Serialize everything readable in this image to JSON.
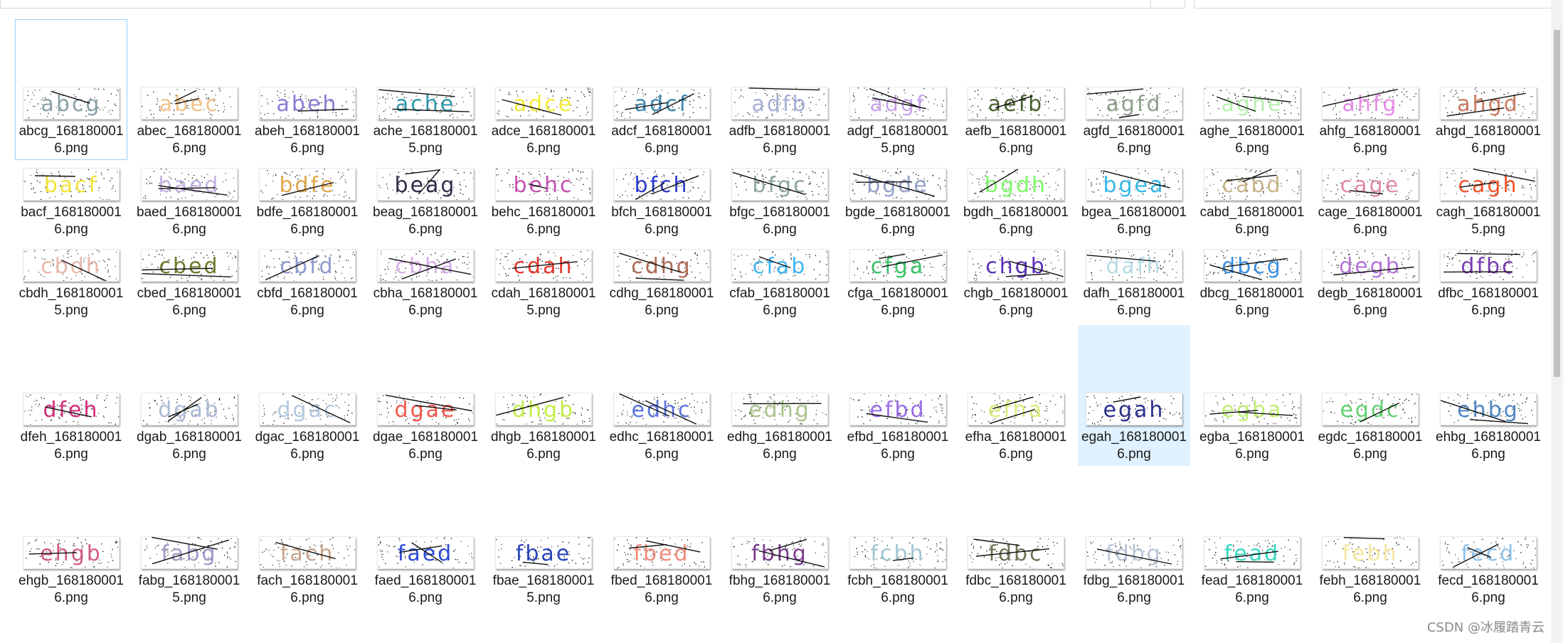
{
  "watermark": "CSDN @冰履踏青云",
  "files": [
    {
      "text": "abcg",
      "name": "abcg_1681800016.png",
      "color": "#8aa0a6"
    },
    {
      "text": "abec",
      "name": "abec_1681800016.png",
      "color": "#f1c48b"
    },
    {
      "text": "abeh",
      "name": "abeh_1681800016.png",
      "color": "#8c7ad6"
    },
    {
      "text": "ache",
      "name": "ache_1681800015.png",
      "color": "#2d97a8"
    },
    {
      "text": "adce",
      "name": "adce_1681800016.png",
      "color": "#f3ec36"
    },
    {
      "text": "adcf",
      "name": "adcf_1681800016.png",
      "color": "#3b86b0"
    },
    {
      "text": "adfb",
      "name": "adfb_1681800016.png",
      "color": "#a5b0d8"
    },
    {
      "text": "adgf",
      "name": "adgf_1681800015.png",
      "color": "#c7a3e8"
    },
    {
      "text": "aefb",
      "name": "aefb_1681800016.png",
      "color": "#4a6231"
    },
    {
      "text": "agfd",
      "name": "agfd_1681800016.png",
      "color": "#8ea08a"
    },
    {
      "text": "aghe",
      "name": "aghe_1681800016.png",
      "color": "#b8eeb0"
    },
    {
      "text": "ahfg",
      "name": "ahfg_1681800016.png",
      "color": "#e58be6"
    },
    {
      "text": "ahgd",
      "name": "ahgd_1681800016.png",
      "color": "#cb7a61"
    },
    {
      "text": "bacf",
      "name": "bacf_1681800016.png",
      "color": "#f3e23a"
    },
    {
      "text": "baed",
      "name": "baed_1681800016.png",
      "color": "#c4b5e2"
    },
    {
      "text": "bdfe",
      "name": "bdfe_1681800016.png",
      "color": "#e0a54a"
    },
    {
      "text": "beag",
      "name": "beag_1681800016.png",
      "color": "#2e2f4a"
    },
    {
      "text": "behc",
      "name": "behc_1681800016.png",
      "color": "#c54fb1"
    },
    {
      "text": "bfch",
      "name": "bfch_1681800016.png",
      "color": "#2b3ac9"
    },
    {
      "text": "bfgc",
      "name": "bfgc_1681800016.png",
      "color": "#8da79a"
    },
    {
      "text": "bgde",
      "name": "bgde_1681800016.png",
      "color": "#93a0c8"
    },
    {
      "text": "bgdh",
      "name": "bgdh_1681800016.png",
      "color": "#7ff56a"
    },
    {
      "text": "bgea",
      "name": "bgea_1681800016.png",
      "color": "#36b7e8"
    },
    {
      "text": "cabd",
      "name": "cabd_1681800016.png",
      "color": "#c9b58a"
    },
    {
      "text": "cage",
      "name": "cage_1681800016.png",
      "color": "#e08aa3"
    },
    {
      "text": "cagh",
      "name": "cagh_1681800015.png",
      "color": "#f0552a"
    },
    {
      "text": "cbdh",
      "name": "cbdh_1681800015.png",
      "color": "#e8b8a8"
    },
    {
      "text": "cbed",
      "name": "cbed_1681800016.png",
      "color": "#6f7a2b"
    },
    {
      "text": "cbfd",
      "name": "cbfd_1681800016.png",
      "color": "#8e9ad0"
    },
    {
      "text": "cbha",
      "name": "cbha_1681800016.png",
      "color": "#d7aee8"
    },
    {
      "text": "cdah",
      "name": "cdah_1681800015.png",
      "color": "#e4382e"
    },
    {
      "text": "cdhg",
      "name": "cdhg_1681800016.png",
      "color": "#b06d57"
    },
    {
      "text": "cfab",
      "name": "cfab_1681800016.png",
      "color": "#3fb6f2"
    },
    {
      "text": "cfga",
      "name": "cfga_1681800016.png",
      "color": "#3bc267"
    },
    {
      "text": "chgb",
      "name": "chgb_1681800016.png",
      "color": "#5b2fb7"
    },
    {
      "text": "dafh",
      "name": "dafh_1681800016.png",
      "color": "#b7dbe6"
    },
    {
      "text": "dbcg",
      "name": "dbcg_1681800016.png",
      "color": "#3a8fe0"
    },
    {
      "text": "degb",
      "name": "degb_1681800016.png",
      "color": "#b272d6"
    },
    {
      "text": "dfbc",
      "name": "dfbc_1681800016.png",
      "color": "#7a3cb3"
    },
    {
      "text": "dfeh",
      "name": "dfeh_1681800016.png",
      "color": "#d12f7c"
    },
    {
      "text": "dgab",
      "name": "dgab_1681800016.png",
      "color": "#aab8d4"
    },
    {
      "text": "dgac",
      "name": "dgac_1681800016.png",
      "color": "#b5c8df"
    },
    {
      "text": "dgae",
      "name": "dgae_1681800016.png",
      "color": "#f2574b"
    },
    {
      "text": "dhgb",
      "name": "dhgb_1681800016.png",
      "color": "#c1ee45"
    },
    {
      "text": "edhc",
      "name": "edhc_1681800016.png",
      "color": "#5b74e0"
    },
    {
      "text": "edhg",
      "name": "edhg_1681800016.png",
      "color": "#a9c289"
    },
    {
      "text": "efbd",
      "name": "efbd_1681800016.png",
      "color": "#9a6de8"
    },
    {
      "text": "efha",
      "name": "efha_1681800016.png",
      "color": "#d6ec7a"
    },
    {
      "text": "egah",
      "name": "egah_1681800016.png",
      "color": "#2a2f8c"
    },
    {
      "text": "egba",
      "name": "egba_1681800016.png",
      "color": "#c0ef75"
    },
    {
      "text": "egdc",
      "name": "egdc_1681800016.png",
      "color": "#5ed16d"
    },
    {
      "text": "ehbg",
      "name": "ehbg_1681800016.png",
      "color": "#4f86c4"
    },
    {
      "text": "ehgb",
      "name": "ehgb_1681800016.png",
      "color": "#cf5c84"
    },
    {
      "text": "fabg",
      "name": "fabg_1681800015.png",
      "color": "#9d98c6"
    },
    {
      "text": "fach",
      "name": "fach_1681800016.png",
      "color": "#c9a48c"
    },
    {
      "text": "faed",
      "name": "faed_1681800016.png",
      "color": "#2e4ad6"
    },
    {
      "text": "fbae",
      "name": "fbae_1681800015.png",
      "color": "#2a45b8"
    },
    {
      "text": "fbed",
      "name": "fbed_1681800016.png",
      "color": "#f08a79"
    },
    {
      "text": "fbhg",
      "name": "fbhg_1681800016.png",
      "color": "#7a3a8e"
    },
    {
      "text": "fcbh",
      "name": "fcbh_1681800016.png",
      "color": "#9fc7d2"
    },
    {
      "text": "fdbc",
      "name": "fdbc_1681800016.png",
      "color": "#6e7555"
    },
    {
      "text": "fdbg",
      "name": "fdbg_1681800016.png",
      "color": "#b9c4d8"
    },
    {
      "text": "fead",
      "name": "fead_1681800016.png",
      "color": "#37d9c1"
    },
    {
      "text": "febh",
      "name": "febh_1681800016.png",
      "color": "#f7e6a2"
    },
    {
      "text": "fecd",
      "name": "fecd_1681800016.png",
      "color": "#8fc2ea"
    }
  ]
}
